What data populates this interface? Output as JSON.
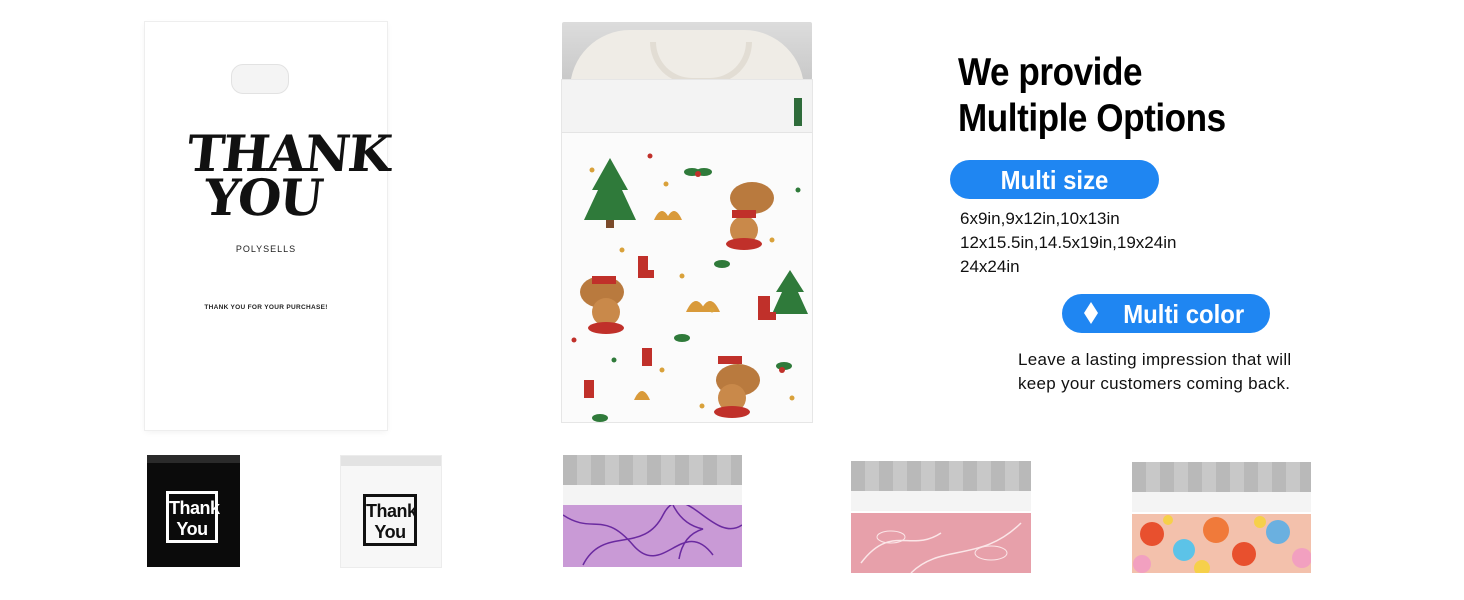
{
  "bag_white": {
    "thank": "THANK",
    "you": "YOU",
    "brand": "POLYSELLS",
    "note": "THANK YOU FOR YOUR PURCHASE!"
  },
  "headline": {
    "line1": "We provide",
    "line2": "Multiple Options"
  },
  "multi_size": {
    "label": "Multi size",
    "sizes": [
      "6x9in,9x12in,10x13in",
      "12x15.5in,14.5x19in,19x24in",
      "24x24in"
    ]
  },
  "multi_color": {
    "label": "Multi color",
    "icon": "diamond-icon",
    "description": "Leave a lasting impression that will keep your customers coming back."
  },
  "swatches": {
    "black_text_1": "Thank",
    "black_text_2": "You",
    "white_text_1": "Thank",
    "white_text_2": "You"
  },
  "colors": {
    "accent_blue": "#1f86f2",
    "purple_print": "#c99ad6",
    "pink_print": "#e7a0aa",
    "floral_print": "#f3c1ac"
  }
}
